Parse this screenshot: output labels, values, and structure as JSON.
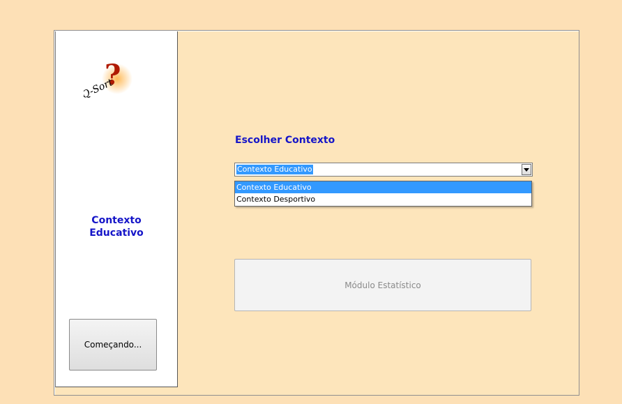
{
  "sidebar": {
    "logo_text": "Q-Sort?",
    "context_label": "Contexto\nEducativo",
    "start_button": "Começando..."
  },
  "main": {
    "choose_title": "Escolher Contexto",
    "combo_value": "Contexto Educativo",
    "dropdown_options": [
      "Contexto Educativo",
      "Contexto Desportivo"
    ],
    "stats_button": "Módulo Estatístico"
  },
  "colors": {
    "background": "#fde0b6",
    "accent_text": "#1515c8",
    "selection": "#3399ff"
  }
}
